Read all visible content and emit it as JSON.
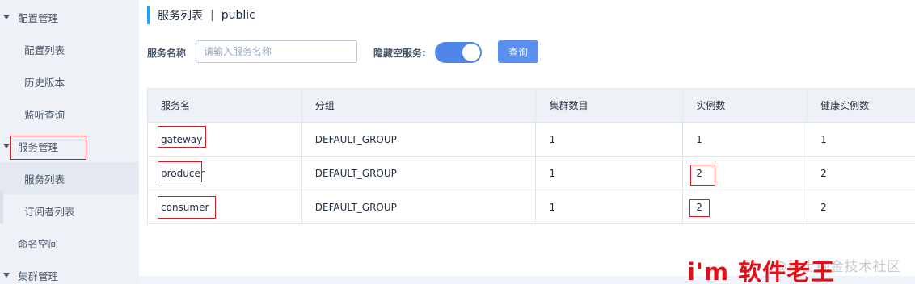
{
  "sidebar": {
    "items": [
      {
        "label": "配置管理"
      },
      {
        "label": "配置列表"
      },
      {
        "label": "历史版本"
      },
      {
        "label": "监听查询"
      },
      {
        "label": "服务管理"
      },
      {
        "label": "服务列表"
      },
      {
        "label": "订阅者列表"
      },
      {
        "label": "命名空间"
      },
      {
        "label": "集群管理"
      }
    ]
  },
  "header": {
    "title": "服务列表",
    "separator": "|",
    "namespace": "public"
  },
  "filters": {
    "service_name_label": "服务名称",
    "service_name_placeholder": "请输入服务名称",
    "hide_empty_label": "隐藏空服务:",
    "hide_empty_enabled": true,
    "query_label": "查询"
  },
  "table": {
    "headers": [
      "服务名",
      "分组",
      "集群数目",
      "实例数",
      "健康实例数"
    ],
    "rows": [
      {
        "name": "gateway",
        "group": "DEFAULT_GROUP",
        "clusters": "1",
        "instances": "1",
        "healthy": "1"
      },
      {
        "name": "producer",
        "group": "DEFAULT_GROUP",
        "clusters": "1",
        "instances": "2",
        "healthy": "2"
      },
      {
        "name": "consumer",
        "group": "DEFAULT_GROUP",
        "clusters": "1",
        "instances": "2",
        "healthy": "2"
      }
    ]
  },
  "watermark": {
    "faded": "@稀土掘金技术社区",
    "main": "i'm 软件老王"
  },
  "colors": {
    "accent": "#20a0ff",
    "toggle_on": "#4f86e8",
    "button": "#5a8ff0",
    "highlight_border": "#e0181f",
    "sidebar_bg": "#eef1f6"
  }
}
